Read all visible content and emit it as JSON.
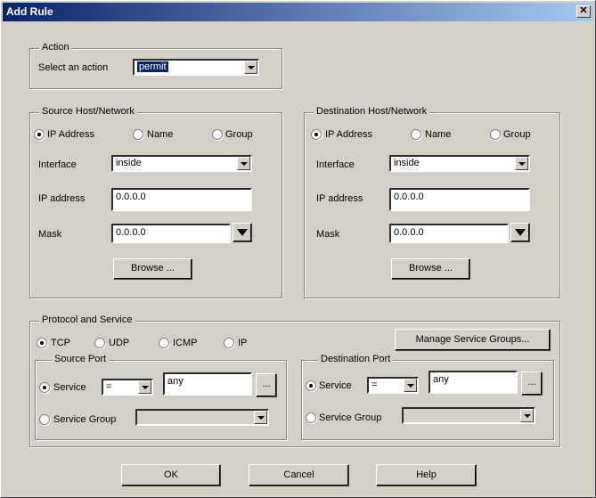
{
  "window": {
    "title": "Add Rule",
    "close_glyph": "✕"
  },
  "action": {
    "legend": "Action",
    "select_label": "Select an action",
    "selected": "permit"
  },
  "source": {
    "legend": "Source Host/Network",
    "radios": {
      "ip": "IP Address",
      "name": "Name",
      "group": "Group"
    },
    "interface_label": "Interface",
    "interface_value": "inside",
    "ip_label": "IP address",
    "ip_value": "0.0.0.0",
    "mask_label": "Mask",
    "mask_value": "0.0.0.0",
    "browse": "Browse ..."
  },
  "destination": {
    "legend": "Destination Host/Network",
    "radios": {
      "ip": "IP Address",
      "name": "Name",
      "group": "Group"
    },
    "interface_label": "Interface",
    "interface_value": "inside",
    "ip_label": "IP address",
    "ip_value": "0.0.0.0",
    "mask_label": "Mask",
    "mask_value": "0.0.0.0",
    "browse": "Browse ..."
  },
  "protocol": {
    "legend": "Protocol and Service",
    "tcp": "TCP",
    "udp": "UDP",
    "icmp": "ICMP",
    "ip": "IP",
    "manage": "Manage Service Groups...",
    "source_port": {
      "legend": "Source Port",
      "service": "Service",
      "op": "=",
      "value": "any",
      "more": "...",
      "service_group": "Service Group"
    },
    "dest_port": {
      "legend": "Destination Port",
      "service": "Service",
      "op": "=",
      "value": "any",
      "more": "...",
      "service_group": "Service Group"
    }
  },
  "buttons": {
    "ok": "OK",
    "cancel": "Cancel",
    "help": "Help"
  }
}
